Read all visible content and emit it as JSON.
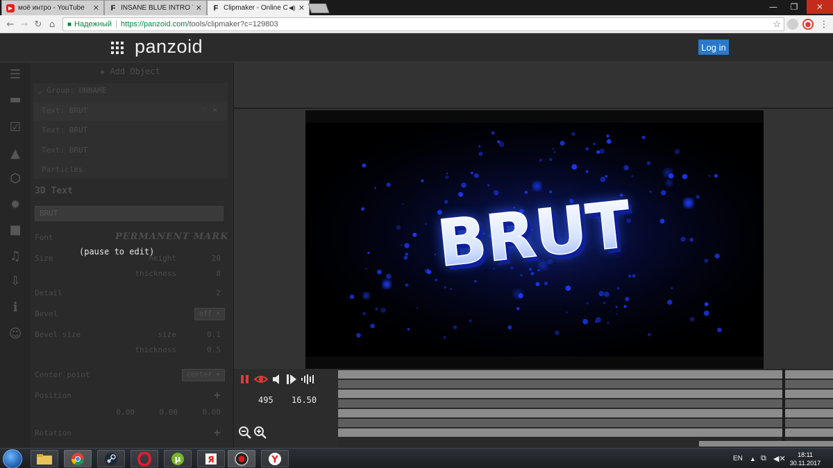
{
  "browser": {
    "tabs": [
      {
        "title": "моё интро - YouTube",
        "favicon": "youtube-icon"
      },
      {
        "title": "INSANE BLUE INTRO TEM",
        "favicon": "panzoid-icon"
      },
      {
        "title": "Clipmaker - Online C",
        "favicon": "panzoid-icon"
      }
    ],
    "security_label": "Надежный",
    "url_host": "https://panzoid.com",
    "url_path": "/tools/clipmaker?c=129803"
  },
  "header": {
    "brand": "panzoid",
    "login_label": "Log in"
  },
  "panel": {
    "add_object": "Add Object",
    "group_label": "Group: UNNAME",
    "layers": [
      "Text: BRUT",
      "Text: BRUT",
      "Text: BRUT",
      "Particles"
    ],
    "section_title": "3D Text",
    "text_value": "BRUT",
    "font_label": "Font",
    "font_value": "PERMANENT MARK",
    "size_label": "Size",
    "height_label": "height",
    "height_value": "20",
    "thickness_label": "thickness",
    "thickness_value": "8",
    "detail_label": "Detail",
    "detail_value": "2",
    "bevel_label": "Bevel",
    "bevel_value": "off",
    "bevel_size_label": "Bevel size",
    "bevel_size_sub": "size",
    "bevel_size_value": "0.1",
    "bevel_thickness_label": "thickness",
    "bevel_thickness_value": "0.5",
    "center_label": "Center point",
    "center_value": "center",
    "position_label": "Position",
    "position_values": [
      "0.00",
      "0.00",
      "0.00"
    ],
    "rotation_label": "Rotation",
    "pause_message": "(pause to edit)"
  },
  "preview": {
    "text": "BRUT",
    "accent": "#1a3cff"
  },
  "timeline": {
    "frame": "495",
    "time": "16.50"
  },
  "taskbar": {
    "lang": "EN",
    "time": "18:11",
    "date": "30.11.2017"
  }
}
